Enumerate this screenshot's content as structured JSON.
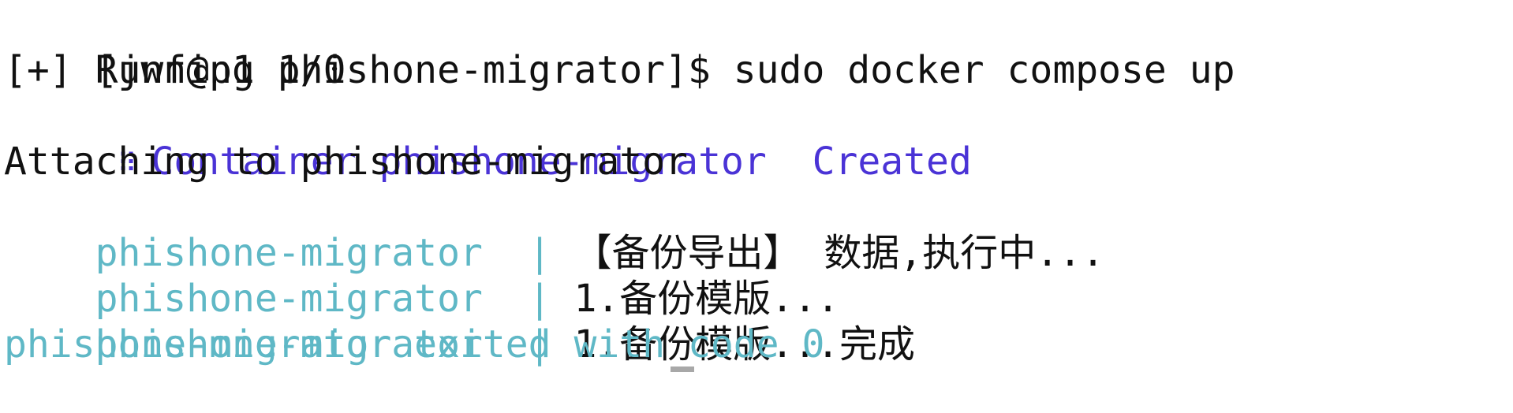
{
  "terminal": {
    "prompt": "[jwf@p1 phishone-migrator]$ ",
    "command": "sudo docker compose up",
    "running_status": "[+] Running 1/0",
    "container_icon": "braille-spinner-icon",
    "container_label": "Container phishone-migrator",
    "container_state": "Created",
    "attaching": "Attaching to phishone-migrator",
    "log_lines": [
      {
        "service": "phishone-migrator",
        "separator": "|",
        "message": "【备份导出】 数据,执行中..."
      },
      {
        "service": "phishone-migrator",
        "separator": "|",
        "message": "1.备份模版..."
      },
      {
        "service": "phishone-migrator",
        "separator": "|",
        "message": "1.备份模版...完成"
      }
    ],
    "exit_message": "phishone-migrator exited with code 0",
    "colors": {
      "status_blue": "#4a33d6",
      "service_cyan": "#5fb8c6",
      "text": "#111111",
      "cursor": "#a8a8a8"
    }
  }
}
